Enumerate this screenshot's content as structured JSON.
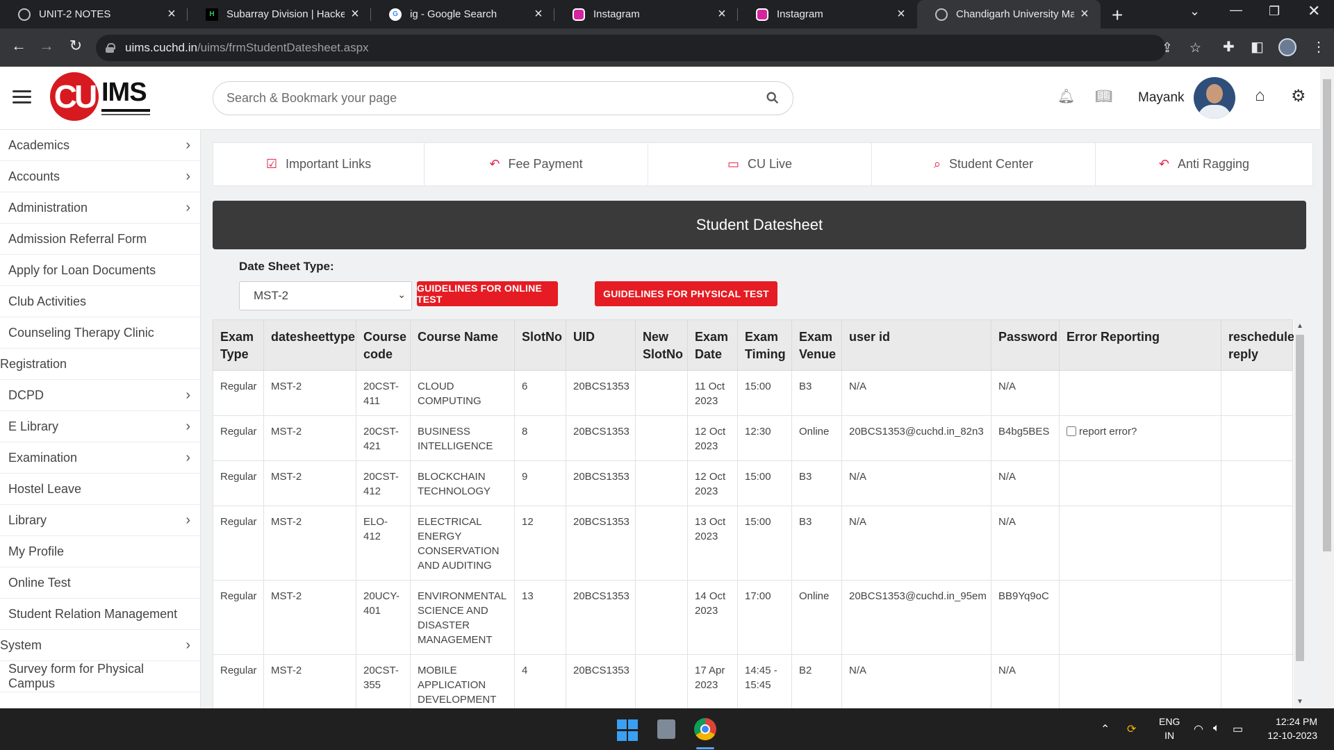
{
  "browser": {
    "tabs": [
      {
        "title": "UNIT-2 NOTES",
        "icon": "globe-icon"
      },
      {
        "title": "Subarray Division | HackerR",
        "icon": "hackerrank-icon"
      },
      {
        "title": "ig - Google Search",
        "icon": "google-icon"
      },
      {
        "title": "Instagram",
        "icon": "instagram-icon"
      },
      {
        "title": "Instagram",
        "icon": "instagram-icon"
      },
      {
        "title": "Chandigarh University Man",
        "icon": "globe-icon"
      }
    ],
    "url_host": "uims.cuchd.in",
    "url_path": "/uims/frmStudentDatesheet.aspx"
  },
  "header": {
    "logo_text": "CU",
    "logo_ims": "IMS",
    "search_placeholder": "Search & Bookmark your page",
    "username": "Mayank"
  },
  "sidebar": {
    "items": [
      {
        "label": "Academics",
        "chevron": true
      },
      {
        "label": "Accounts",
        "chevron": true
      },
      {
        "label": "Administration",
        "chevron": true
      },
      {
        "label": "Admission Referral Form",
        "chevron": false
      },
      {
        "label": "Apply for Loan Documents",
        "chevron": false
      },
      {
        "label": "Club Activities",
        "chevron": false
      },
      {
        "label": "Counseling Therapy Clinic",
        "chevron": false
      },
      {
        "label": "Registration",
        "chevron": false,
        "flush": true
      },
      {
        "label": "DCPD",
        "chevron": true
      },
      {
        "label": "E Library",
        "chevron": true
      },
      {
        "label": "Examination",
        "chevron": true
      },
      {
        "label": "Hostel Leave",
        "chevron": false
      },
      {
        "label": "Library",
        "chevron": true
      },
      {
        "label": "My Profile",
        "chevron": false
      },
      {
        "label": "Online Test",
        "chevron": false
      },
      {
        "label": "Student Relation Management",
        "chevron": false
      },
      {
        "label": "System",
        "chevron": true,
        "flush": true
      },
      {
        "label": "Survey form for Physical Campus",
        "chevron": false
      }
    ]
  },
  "quick_links": [
    {
      "label": "Important Links",
      "icon": "checkbox-icon"
    },
    {
      "label": "Fee Payment",
      "icon": "reply-arrow-icon"
    },
    {
      "label": "CU Live",
      "icon": "monitor-icon"
    },
    {
      "label": "Student Center",
      "icon": "search-icon"
    },
    {
      "label": "Anti Ragging",
      "icon": "reply-arrow-icon"
    }
  ],
  "page": {
    "title": "Student Datesheet",
    "datesheet_type_label": "Date Sheet Type:",
    "datesheet_type_value": "MST-2",
    "btn_online": "GUIDELINES FOR ONLINE TEST",
    "btn_physical": "GUIDELINES FOR PHYSICAL TEST"
  },
  "table": {
    "columns": [
      "Exam Type",
      "datesheettype",
      "Course code",
      "Course Name",
      "SlotNo",
      "UID",
      "New SlotNo",
      "Exam Date",
      "Exam Timing",
      "Exam Venue",
      "user id",
      "Password",
      "Error Reporting",
      "reschedule reply"
    ],
    "rows": [
      [
        "Regular",
        "MST-2",
        "20CST-411",
        "CLOUD COMPUTING",
        "6",
        "20BCS1353",
        "",
        "11 Oct 2023",
        "15:00",
        "B3",
        "N/A",
        "N/A",
        "",
        ""
      ],
      [
        "Regular",
        "MST-2",
        "20CST-421",
        "BUSINESS INTELLIGENCE",
        "8",
        "20BCS1353",
        "",
        "12 Oct 2023",
        "12:30",
        "Online",
        "20BCS1353@cuchd.in_82n3",
        "B4bg5BES",
        "report error?",
        ""
      ],
      [
        "Regular",
        "MST-2",
        "20CST-412",
        "BLOCKCHAIN TECHNOLOGY",
        "9",
        "20BCS1353",
        "",
        "12 Oct 2023",
        "15:00",
        "B3",
        "N/A",
        "N/A",
        "",
        ""
      ],
      [
        "Regular",
        "MST-2",
        "ELO-412",
        "ELECTRICAL ENERGY CONSERVATION AND AUDITING",
        "12",
        "20BCS1353",
        "",
        "13 Oct 2023",
        "15:00",
        "B3",
        "N/A",
        "N/A",
        "",
        ""
      ],
      [
        "Regular",
        "MST-2",
        "20UCY-401",
        "ENVIRONMENTAL SCIENCE AND DISASTER MANAGEMENT",
        "13",
        "20BCS1353",
        "",
        "14 Oct 2023",
        "17:00",
        "Online",
        "20BCS1353@cuchd.in_95em",
        "BB9Yq9oC",
        "",
        ""
      ],
      [
        "Regular",
        "MST-2",
        "20CST-355",
        "MOBILE APPLICATION DEVELOPMENT",
        "4",
        "20BCS1353",
        "",
        "17 Apr 2023",
        "14:45 - 15:45",
        "B2",
        "N/A",
        "N/A",
        "",
        ""
      ]
    ]
  },
  "taskbar": {
    "lang_top": "ENG",
    "lang_bottom": "IN",
    "time": "12:24 PM",
    "date": "12-10-2023"
  }
}
